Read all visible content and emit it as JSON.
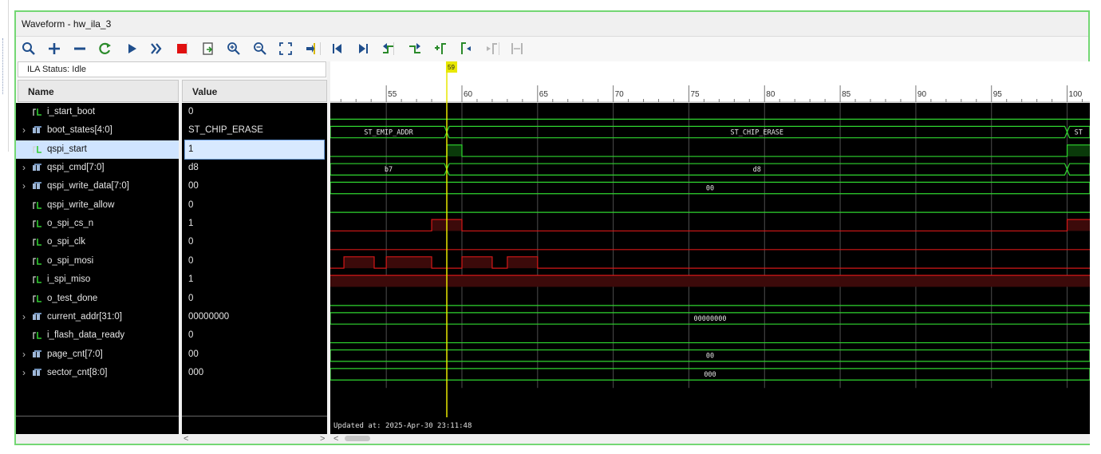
{
  "window": {
    "title": "Waveform - hw_ila_3"
  },
  "toolbar": {
    "buttons": [
      {
        "name": "search-icon"
      },
      {
        "name": "zoom-add-icon"
      },
      {
        "name": "remove-icon"
      },
      {
        "name": "refresh-icon"
      },
      {
        "name": "run-icon"
      },
      {
        "name": "run-fast-icon"
      },
      {
        "name": "stop-icon"
      },
      {
        "name": "export-icon"
      },
      {
        "name": "zoom-in-icon"
      },
      {
        "name": "zoom-out-icon"
      },
      {
        "name": "zoom-fit-icon"
      },
      {
        "name": "goto-cursor-icon"
      },
      {
        "name": "go-first-icon"
      },
      {
        "name": "go-last-icon"
      },
      {
        "name": "prev-transition-icon"
      },
      {
        "name": "next-transition-icon"
      },
      {
        "name": "add-marker-icon"
      },
      {
        "name": "prev-marker-icon"
      },
      {
        "name": "next-marker-icon"
      },
      {
        "name": "swap-cursors-icon"
      }
    ]
  },
  "status": {
    "label": "ILA Status:",
    "value": "Idle"
  },
  "columns": {
    "name": "Name",
    "value": "Value"
  },
  "signals": [
    {
      "name": "i_start_boot",
      "value": "0",
      "bus": false
    },
    {
      "name": "boot_states[4:0]",
      "value": "ST_CHIP_ERASE",
      "bus": true
    },
    {
      "name": "qspi_start",
      "value": "1",
      "bus": false,
      "selected": true
    },
    {
      "name": "qspi_cmd[7:0]",
      "value": "d8",
      "bus": true
    },
    {
      "name": "qspi_write_data[7:0]",
      "value": "00",
      "bus": true
    },
    {
      "name": "qspi_write_allow",
      "value": "0",
      "bus": false
    },
    {
      "name": "o_spi_cs_n",
      "value": "1",
      "bus": false
    },
    {
      "name": "o_spi_clk",
      "value": "0",
      "bus": false
    },
    {
      "name": "o_spi_mosi",
      "value": "0",
      "bus": false
    },
    {
      "name": "i_spi_miso",
      "value": "1",
      "bus": false
    },
    {
      "name": "o_test_done",
      "value": "0",
      "bus": false
    },
    {
      "name": "current_addr[31:0]",
      "value": "00000000",
      "bus": true
    },
    {
      "name": "i_flash_data_ready",
      "value": "0",
      "bus": false
    },
    {
      "name": "page_cnt[7:0]",
      "value": "00",
      "bus": true
    },
    {
      "name": "sector_cnt[8:0]",
      "value": "000",
      "bus": true
    }
  ],
  "scrollbar": {
    "left_arrow": "<",
    "right_arrow": ">"
  },
  "waveform": {
    "updated": "Updated at: 2025-Apr-30 23:11:48",
    "cursor": {
      "label": "59",
      "time": 59
    },
    "time_range": [
      51.3,
      101.5
    ],
    "tick_labels": [
      55,
      60,
      65,
      70,
      75,
      80,
      85,
      90,
      95,
      100
    ],
    "colors": {
      "bus": "#2fd62f",
      "low": "#2fd62f",
      "high_fill": "#3c0a0a",
      "high_line": "#d41818",
      "cursor": "#e8e800",
      "grid": "#4d4d4d",
      "bg": "#000000"
    },
    "tracks": [
      {
        "type": "bit",
        "color": "green",
        "segments": [
          [
            51.3,
            101.5,
            0
          ]
        ]
      },
      {
        "type": "bus",
        "segments": [
          [
            51.3,
            59,
            "ST_EMIP_ADDR"
          ],
          [
            59,
            100,
            "ST_CHIP_ERASE"
          ],
          [
            100,
            101.5,
            "ST"
          ]
        ]
      },
      {
        "type": "bit",
        "color": "green",
        "segments": [
          [
            51.3,
            59,
            0
          ],
          [
            59,
            60,
            1
          ],
          [
            60,
            100,
            0
          ],
          [
            100,
            101.5,
            1
          ]
        ]
      },
      {
        "type": "bus",
        "segments": [
          [
            51.3,
            59,
            "b7"
          ],
          [
            59,
            100,
            "d8"
          ],
          [
            100,
            101.5,
            ""
          ]
        ]
      },
      {
        "type": "bus",
        "segments": [
          [
            51.3,
            101.5,
            "00"
          ]
        ]
      },
      {
        "type": "bit",
        "color": "green",
        "segments": [
          [
            51.3,
            101.5,
            0
          ]
        ]
      },
      {
        "type": "bit",
        "color": "red",
        "segments": [
          [
            51.3,
            58,
            0
          ],
          [
            58,
            60,
            1
          ],
          [
            60,
            100,
            0
          ],
          [
            100,
            101.5,
            1
          ]
        ]
      },
      {
        "type": "bit",
        "color": "red",
        "segments": [
          [
            51.3,
            101.5,
            0
          ]
        ]
      },
      {
        "type": "bit",
        "color": "red",
        "segments": [
          [
            51.3,
            52.2,
            0
          ],
          [
            52.2,
            54.2,
            1
          ],
          [
            54.2,
            55,
            0
          ],
          [
            55,
            58,
            1
          ],
          [
            58,
            60,
            0
          ],
          [
            60,
            62,
            1
          ],
          [
            62,
            63,
            0
          ],
          [
            63,
            65,
            1
          ],
          [
            65,
            101.5,
            0
          ]
        ]
      },
      {
        "type": "bit",
        "color": "red",
        "segments": [
          [
            51.3,
            101.5,
            1
          ]
        ]
      },
      {
        "type": "bit",
        "color": "green",
        "segments": [
          [
            51.3,
            101.5,
            0
          ]
        ]
      },
      {
        "type": "bus",
        "segments": [
          [
            51.3,
            101.5,
            "00000000"
          ]
        ]
      },
      {
        "type": "bit",
        "color": "green",
        "segments": [
          [
            51.3,
            101.5,
            0
          ]
        ]
      },
      {
        "type": "bus",
        "segments": [
          [
            51.3,
            101.5,
            "00"
          ]
        ]
      },
      {
        "type": "bus",
        "segments": [
          [
            51.3,
            101.5,
            "000"
          ]
        ]
      }
    ]
  }
}
